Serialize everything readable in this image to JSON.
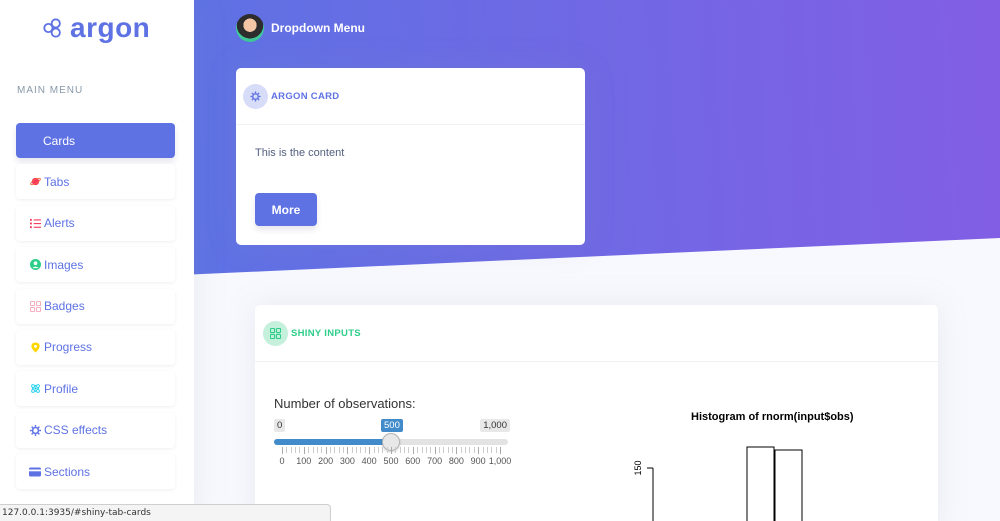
{
  "brand": {
    "name": "argon"
  },
  "sidebar": {
    "heading": "MAIN MENU",
    "items": [
      {
        "label": "Cards",
        "icon": "none",
        "active": true
      },
      {
        "label": "Tabs",
        "icon": "planet-icon",
        "color": "#f5365c"
      },
      {
        "label": "Alerts",
        "icon": "bullet-list-icon",
        "color": "#f5365c"
      },
      {
        "label": "Images",
        "icon": "user-circle-icon",
        "color": "#2dce89"
      },
      {
        "label": "Badges",
        "icon": "ui-blocks-icon",
        "color": "#f3a4b5"
      },
      {
        "label": "Progress",
        "icon": "map-pin-icon",
        "color": "#ffd600"
      },
      {
        "label": "Profile",
        "icon": "atom-icon",
        "color": "#11cdef"
      },
      {
        "label": "CSS effects",
        "icon": "gear-icon",
        "color": "#5e72e4"
      },
      {
        "label": "Sections",
        "icon": "credit-card-icon",
        "color": "#5e72e4"
      }
    ]
  },
  "topnav": {
    "label": "Dropdown Menu"
  },
  "argon_card": {
    "title": "ARGON CARD",
    "content": "This is the content",
    "button": "More"
  },
  "shiny_card": {
    "title": "SHINY INPUTS",
    "slider": {
      "label": "Number of observations:",
      "min_label": "0",
      "value_label": "500",
      "max_label": "1,000",
      "value": 500,
      "min": 0,
      "max": 1000,
      "tick_labels": [
        "0",
        "100",
        "200",
        "300",
        "400",
        "500",
        "600",
        "700",
        "800",
        "900",
        "1,000"
      ]
    },
    "plot": {
      "title": "Histogram of rnorm(input$obs)",
      "y_tick": "150"
    }
  },
  "colors": {
    "primary": "#5e72e4",
    "gradient_end": "#825ee4",
    "success": "#2dce89",
    "slider": "#428bca"
  },
  "status_url": "127.0.0.1:3935/#shiny-tab-cards"
}
